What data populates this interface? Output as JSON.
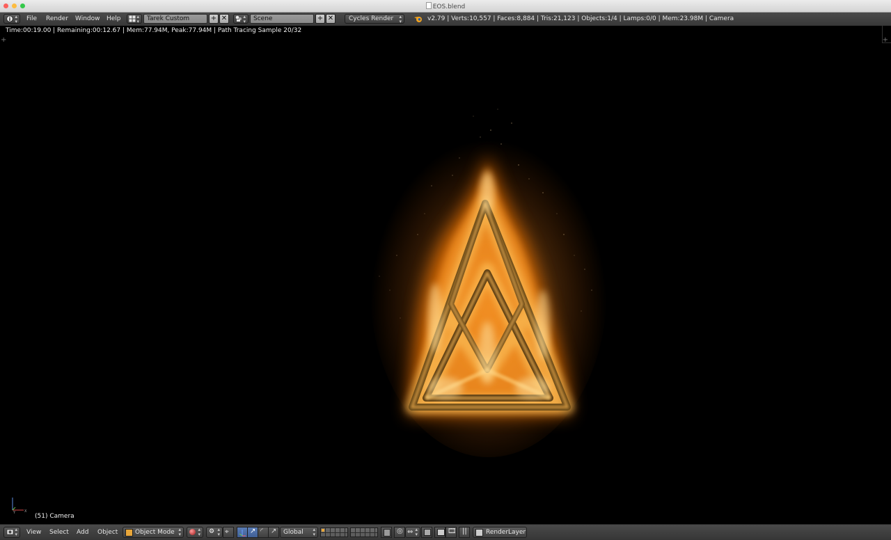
{
  "window": {
    "title": "EOS.blend"
  },
  "top_header": {
    "menus": [
      "File",
      "Render",
      "Window",
      "Help"
    ],
    "screen_layout": "Tarek Custom",
    "scene": "Scene",
    "render_engine": "Cycles Render",
    "stats": "v2.79 | Verts:10,557 | Faces:8,884 | Tris:21,123 | Objects:1/4 | Lamps:0/0 | Mem:23.98M | Camera"
  },
  "viewport": {
    "render_info": "Time:00:19.00 | Remaining:00:12.67 | Mem:77.94M, Peak:77.94M | Path Tracing Sample 20/32",
    "camera_label": "(51) Camera"
  },
  "bottom_header": {
    "menus": [
      "View",
      "Select",
      "Add",
      "Object"
    ],
    "mode": "Object Mode",
    "orientation": "Global",
    "render_layer": "RenderLayer"
  },
  "icons": {
    "editor_type": "info-icon",
    "screen_layout": "layout-icon",
    "scene": "scene-icon",
    "blender_logo": "blender-logo-icon",
    "view_editor": "3d-view-icon",
    "mode": "cube-icon"
  },
  "colors": {
    "header_bg": "#3d3d3d",
    "viewport_bg": "#000000",
    "flame_core": "#ffd27a",
    "flame_outer": "#ff7a00",
    "accent_blue": "#5680c2"
  }
}
